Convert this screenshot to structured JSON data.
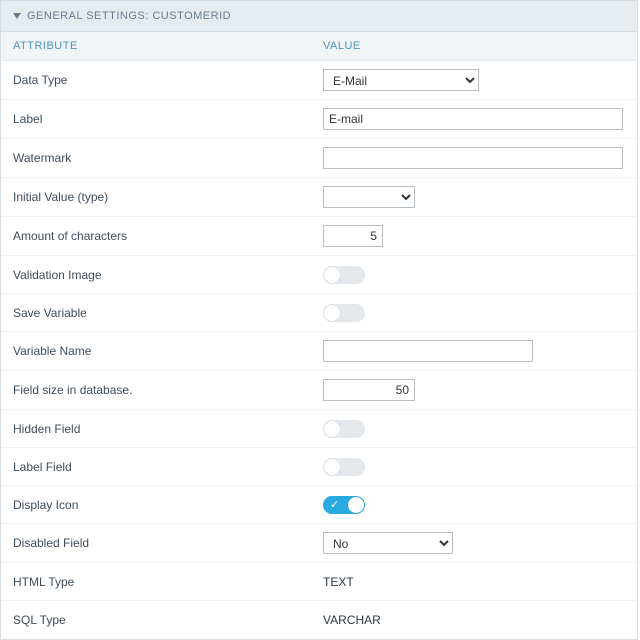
{
  "header": {
    "title": "GENERAL SETTINGS: CUSTOMERID"
  },
  "columns": {
    "attribute": "ATTRIBUTE",
    "value": "VALUE"
  },
  "rows": {
    "data_type": {
      "label": "Data Type",
      "value": "E-Mail"
    },
    "label": {
      "label": "Label",
      "value": "E-mail"
    },
    "watermark": {
      "label": "Watermark",
      "value": ""
    },
    "initial": {
      "label": "Initial Value (type)",
      "value": ""
    },
    "amount": {
      "label": "Amount of characters",
      "value": "5"
    },
    "valid_img": {
      "label": "Validation Image",
      "on": false
    },
    "save_var": {
      "label": "Save Variable",
      "on": false
    },
    "var_name": {
      "label": "Variable Name",
      "value": ""
    },
    "field_size": {
      "label": "Field size in database.",
      "value": "50"
    },
    "hidden": {
      "label": "Hidden Field",
      "on": false
    },
    "label_field": {
      "label": "Label Field",
      "on": false
    },
    "display_icon": {
      "label": "Display Icon",
      "on": true
    },
    "disabled": {
      "label": "Disabled Field",
      "value": "No"
    },
    "html_type": {
      "label": "HTML Type",
      "value": "TEXT"
    },
    "sql_type": {
      "label": "SQL Type",
      "value": "VARCHAR"
    }
  }
}
